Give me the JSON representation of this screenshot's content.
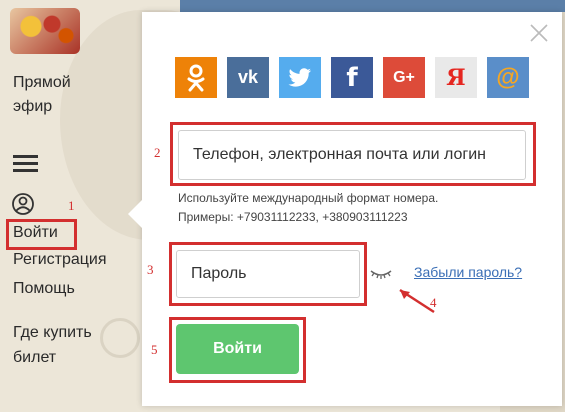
{
  "sidebar": {
    "items": [
      "Прямой",
      "эфир",
      "Войти",
      "Регистрация",
      "Помощь",
      "Где купить",
      "билет"
    ]
  },
  "modal": {
    "social": [
      {
        "name": "odnoklassniki",
        "glyph": "ок",
        "color": "#ee8208"
      },
      {
        "name": "vkontakte",
        "glyph": "vk",
        "color": "#4a6e9a"
      },
      {
        "name": "twitter",
        "glyph": "🐦",
        "color": "#55acee"
      },
      {
        "name": "facebook",
        "glyph": "f",
        "color": "#3b5998"
      },
      {
        "name": "google-plus",
        "glyph": "G+",
        "color": "#dd4b39"
      },
      {
        "name": "yandex",
        "glyph": "Я",
        "color": "#e9e9e9"
      },
      {
        "name": "mail-ru",
        "glyph": "@",
        "color": "#5a8ec9"
      }
    ],
    "login_placeholder": "Телефон, электронная почта или логин",
    "hint_line1": "Используйте международный формат номера.",
    "hint_line2": "Примеры: +79031112233, +380903111223",
    "password_placeholder": "Пароль",
    "forgot_label": "Забыли пароль?",
    "submit_label": "Войти"
  },
  "annotations": [
    "1",
    "2",
    "3",
    "4",
    "5"
  ],
  "colors": {
    "accent": "#5ec66f",
    "annotation": "#d32f2f",
    "link": "#3b6fb6"
  }
}
